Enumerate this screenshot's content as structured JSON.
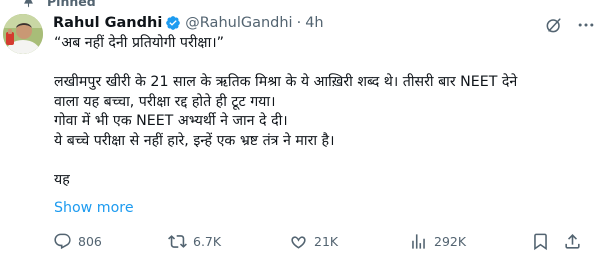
{
  "pinned": {
    "label": "Pinned"
  },
  "author": {
    "name": "Rahul Gandhi",
    "handle": "@RahulGandhi",
    "separator": "·",
    "time": "4h"
  },
  "tweet": {
    "lines": [
      "“अब नहीं देनी प्रतियोगी परीक्षा।”",
      "",
      "लखीमपुर खीरी के 21 साल के ऋतिक मिश्रा के ये आख़िरी शब्द थे। तीसरी बार NEET देने",
      "वाला यह बच्चा, परीक्षा रद्द होते ही टूट गया।",
      "गोवा में भी एक NEET अभ्यर्थी ने जान दे दी।",
      "ये बच्चे परीक्षा से नहीं हारे, इन्हें एक भ्रष्ट तंत्र ने मारा है।",
      "",
      "यह"
    ],
    "show_more": "Show more"
  },
  "actions": {
    "replies": "806",
    "reposts": "6.7K",
    "likes": "21K",
    "views": "292K"
  },
  "icons": {
    "pinned": "pin-icon",
    "verified": "verified-badge-icon",
    "more": "more-options-icon",
    "grok": "grok-icon",
    "reply": "reply-icon",
    "repost": "repost-icon",
    "like": "heart-icon",
    "views": "views-chart-icon",
    "bookmark": "bookmark-icon",
    "share": "share-icon"
  },
  "colors": {
    "text": "#0f1419",
    "secondary": "#536471",
    "accent": "#1d9bf0"
  }
}
